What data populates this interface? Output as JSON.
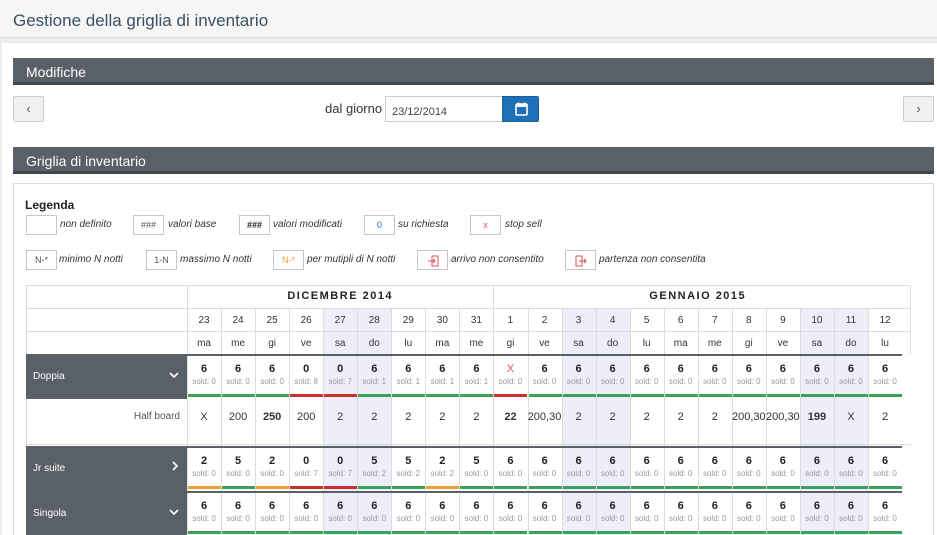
{
  "page_title": "Gestione della griglia di inventario",
  "modifiche": {
    "title": "Modifiche",
    "prev_label": "‹",
    "next_label": "›",
    "date_label": "dal giorno",
    "date_value": "23/12/2014",
    "calendar_icon": "calendar-icon"
  },
  "grid_section_title": "Griglia di inventario",
  "legend": {
    "title": "Legenda",
    "items": [
      {
        "box": "",
        "text": "non definito"
      },
      {
        "box": "###",
        "text": "valori base"
      },
      {
        "box": "###",
        "text": "valori modificati"
      },
      {
        "box": "0",
        "text": "su richiesta"
      },
      {
        "box": "x",
        "text": "stop sell"
      },
      {
        "box": "N-*",
        "text": "minimo N notti"
      },
      {
        "box": "1-N",
        "text": "massimo N notti"
      },
      {
        "box": "N-*",
        "text": "per mutipli di N notti"
      },
      {
        "box": "",
        "text": "arrivo non consentito",
        "icon": "sign-in-icon"
      },
      {
        "box": "",
        "text": "partenza non consentita",
        "icon": "sign-out-icon"
      }
    ]
  },
  "months": [
    {
      "label": "DICEMBRE 2014",
      "span": 9
    },
    {
      "label": "GENNAIO 2015",
      "span": 12
    }
  ],
  "days": [
    {
      "num": "23",
      "name": "ma",
      "weekend": false
    },
    {
      "num": "24",
      "name": "me",
      "weekend": false
    },
    {
      "num": "25",
      "name": "gi",
      "weekend": false
    },
    {
      "num": "26",
      "name": "ve",
      "weekend": false
    },
    {
      "num": "27",
      "name": "sa",
      "weekend": true
    },
    {
      "num": "28",
      "name": "do",
      "weekend": true
    },
    {
      "num": "29",
      "name": "lu",
      "weekend": false
    },
    {
      "num": "30",
      "name": "ma",
      "weekend": false
    },
    {
      "num": "31",
      "name": "me",
      "weekend": false
    },
    {
      "num": "1",
      "name": "gi",
      "weekend": false
    },
    {
      "num": "2",
      "name": "ve",
      "weekend": false
    },
    {
      "num": "3",
      "name": "sa",
      "weekend": true
    },
    {
      "num": "4",
      "name": "do",
      "weekend": true
    },
    {
      "num": "5",
      "name": "lu",
      "weekend": false
    },
    {
      "num": "6",
      "name": "ma",
      "weekend": false
    },
    {
      "num": "7",
      "name": "me",
      "weekend": false
    },
    {
      "num": "8",
      "name": "gi",
      "weekend": false
    },
    {
      "num": "9",
      "name": "ve",
      "weekend": false
    },
    {
      "num": "10",
      "name": "sa",
      "weekend": true
    },
    {
      "num": "11",
      "name": "do",
      "weekend": true
    },
    {
      "num": "12",
      "name": "lu",
      "weekend": false
    }
  ],
  "status_colors": {
    "green": "#3aa05a",
    "red": "#c9302c",
    "orange": "#f0a030"
  },
  "rooms": [
    {
      "name": "Doppia",
      "chevron": "chevron-down-icon",
      "cells": [
        {
          "avail": "6",
          "sold": "sold: 0",
          "status": "green"
        },
        {
          "avail": "6",
          "sold": "sold: 0",
          "status": "green"
        },
        {
          "avail": "6",
          "sold": "sold: 0",
          "status": "green"
        },
        {
          "avail": "0",
          "sold": "sold: 8",
          "status": "red"
        },
        {
          "avail": "0",
          "sold": "sold: 7",
          "status": "red"
        },
        {
          "avail": "6",
          "sold": "sold: 1",
          "status": "green"
        },
        {
          "avail": "6",
          "sold": "sold: 1",
          "status": "green"
        },
        {
          "avail": "6",
          "sold": "sold: 1",
          "status": "green"
        },
        {
          "avail": "6",
          "sold": "sold: 1",
          "status": "green"
        },
        {
          "avail": "X",
          "sold": "sold: 0",
          "status": "red"
        },
        {
          "avail": "6",
          "sold": "sold: 0",
          "status": "green"
        },
        {
          "avail": "6",
          "sold": "sold: 0",
          "status": "green"
        },
        {
          "avail": "6",
          "sold": "sold: 0",
          "status": "green"
        },
        {
          "avail": "6",
          "sold": "sold: 0",
          "status": "green"
        },
        {
          "avail": "6",
          "sold": "sold: 0",
          "status": "green"
        },
        {
          "avail": "6",
          "sold": "sold: 0",
          "status": "green"
        },
        {
          "avail": "6",
          "sold": "sold: 0",
          "status": "green"
        },
        {
          "avail": "6",
          "sold": "sold: 0",
          "status": "green"
        },
        {
          "avail": "6",
          "sold": "sold: 0",
          "status": "green"
        },
        {
          "avail": "6",
          "sold": "sold: 0",
          "status": "green"
        },
        {
          "avail": "6",
          "sold": "sold: 0",
          "status": "green"
        }
      ],
      "rate": {
        "label": "Half board",
        "values": [
          {
            "v": "X",
            "x": true
          },
          {
            "v": "200"
          },
          {
            "v": "250",
            "bold": true
          },
          {
            "v": "200"
          },
          {
            "v": "2"
          },
          {
            "v": "2"
          },
          {
            "v": "2"
          },
          {
            "v": "2"
          },
          {
            "v": "2"
          },
          {
            "v": "22",
            "bold": true
          },
          {
            "v": "200,30"
          },
          {
            "v": "2"
          },
          {
            "v": "2"
          },
          {
            "v": "2"
          },
          {
            "v": "2"
          },
          {
            "v": "2"
          },
          {
            "v": "200,30"
          },
          {
            "v": "200,30"
          },
          {
            "v": "199",
            "bold": true
          },
          {
            "v": "X",
            "x": true
          },
          {
            "v": "2"
          }
        ]
      }
    },
    {
      "name": "Jr suite",
      "chevron": "chevron-right-icon",
      "cells": [
        {
          "avail": "2",
          "sold": "sold: 0",
          "status": "orange"
        },
        {
          "avail": "5",
          "sold": "sold: 0",
          "status": "green"
        },
        {
          "avail": "2",
          "sold": "sold: 0",
          "status": "orange"
        },
        {
          "avail": "0",
          "sold": "sold: 7",
          "status": "red"
        },
        {
          "avail": "0",
          "sold": "sold: 7",
          "status": "red"
        },
        {
          "avail": "5",
          "sold": "sold: 2",
          "status": "green"
        },
        {
          "avail": "5",
          "sold": "sold: 2",
          "status": "green"
        },
        {
          "avail": "2",
          "sold": "sold: 2",
          "status": "orange"
        },
        {
          "avail": "5",
          "sold": "sold: 0",
          "status": "green"
        },
        {
          "avail": "6",
          "sold": "sold: 0",
          "status": "green"
        },
        {
          "avail": "6",
          "sold": "sold: 0",
          "status": "green"
        },
        {
          "avail": "6",
          "sold": "sold: 0",
          "status": "green"
        },
        {
          "avail": "6",
          "sold": "sold: 0",
          "status": "green"
        },
        {
          "avail": "6",
          "sold": "sold: 0",
          "status": "green"
        },
        {
          "avail": "6",
          "sold": "sold: 0",
          "status": "green"
        },
        {
          "avail": "6",
          "sold": "sold: 0",
          "status": "green"
        },
        {
          "avail": "6",
          "sold": "sold: 0",
          "status": "green"
        },
        {
          "avail": "6",
          "sold": "sold: 0",
          "status": "green"
        },
        {
          "avail": "6",
          "sold": "sold: 0",
          "status": "green"
        },
        {
          "avail": "6",
          "sold": "sold: 0",
          "status": "green"
        },
        {
          "avail": "6",
          "sold": "sold: 0",
          "status": "green"
        }
      ]
    },
    {
      "name": "Singola",
      "chevron": "chevron-down-icon",
      "cells": [
        {
          "avail": "6",
          "sold": "sold: 0",
          "status": "green"
        },
        {
          "avail": "6",
          "sold": "sold: 0",
          "status": "green"
        },
        {
          "avail": "6",
          "sold": "sold: 0",
          "status": "green"
        },
        {
          "avail": "6",
          "sold": "sold: 0",
          "status": "green"
        },
        {
          "avail": "6",
          "sold": "sold: 0",
          "status": "green"
        },
        {
          "avail": "6",
          "sold": "sold: 0",
          "status": "green"
        },
        {
          "avail": "6",
          "sold": "sold: 0",
          "status": "green"
        },
        {
          "avail": "6",
          "sold": "sold: 0",
          "status": "green"
        },
        {
          "avail": "6",
          "sold": "sold: 0",
          "status": "green"
        },
        {
          "avail": "6",
          "sold": "sold: 0",
          "status": "green"
        },
        {
          "avail": "6",
          "sold": "sold: 0",
          "status": "green"
        },
        {
          "avail": "6",
          "sold": "sold: 0",
          "status": "green"
        },
        {
          "avail": "6",
          "sold": "sold: 0",
          "status": "green"
        },
        {
          "avail": "6",
          "sold": "sold: 0",
          "status": "green"
        },
        {
          "avail": "6",
          "sold": "sold: 0",
          "status": "green"
        },
        {
          "avail": "6",
          "sold": "sold: 0",
          "status": "green"
        },
        {
          "avail": "6",
          "sold": "sold: 0",
          "status": "green"
        },
        {
          "avail": "6",
          "sold": "sold: 0",
          "status": "green"
        },
        {
          "avail": "6",
          "sold": "sold: 0",
          "status": "green"
        },
        {
          "avail": "6",
          "sold": "sold: 0",
          "status": "green"
        },
        {
          "avail": "6",
          "sold": "sold: 0",
          "status": "green"
        }
      ]
    }
  ]
}
